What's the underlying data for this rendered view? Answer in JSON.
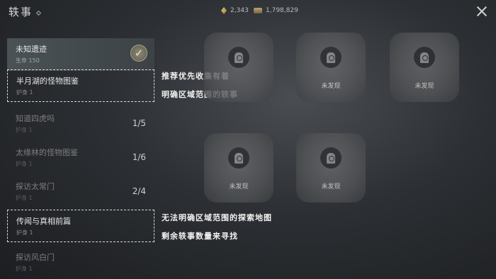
{
  "header": {
    "title": "轶事"
  },
  "currency": [
    {
      "icon": "gem-icon",
      "value": "2,343"
    },
    {
      "icon": "coin-stack-icon",
      "value": "1,798,829"
    }
  ],
  "sidebar": {
    "items": [
      {
        "name": "未知遗迹",
        "sub": "生命 150",
        "count": "",
        "state": "selected"
      },
      {
        "name": "半月湖的怪物图鉴",
        "sub": "护身 1",
        "count": "",
        "state": "highlight"
      },
      {
        "name": "知道四虎吗",
        "sub": "护身 1",
        "count": "1/5",
        "state": "dim"
      },
      {
        "name": "太缘林的怪物图鉴",
        "sub": "护身 1",
        "count": "1/6",
        "state": "dim"
      },
      {
        "name": "探访太常门",
        "sub": "护身 1",
        "count": "2/4",
        "state": "dim"
      },
      {
        "name": "传闻与真相前篇",
        "sub": "护身 1",
        "count": "",
        "state": "highlight"
      },
      {
        "name": "探访风白门",
        "sub": "护身 1",
        "count": "",
        "state": "dim"
      }
    ]
  },
  "annotations": {
    "a1_line1": "推荐优先收集有着",
    "a1_line2": "明确区域范围的轶事",
    "a2_line1": "无法明确区域范围的探索地图",
    "a2_line2": "剩余轶事数量来寻找"
  },
  "cards": [
    {
      "label": ""
    },
    {
      "label": "未发现"
    },
    {
      "label": "未发现"
    },
    {
      "label": "未发现"
    },
    {
      "label": "未发现"
    }
  ]
}
